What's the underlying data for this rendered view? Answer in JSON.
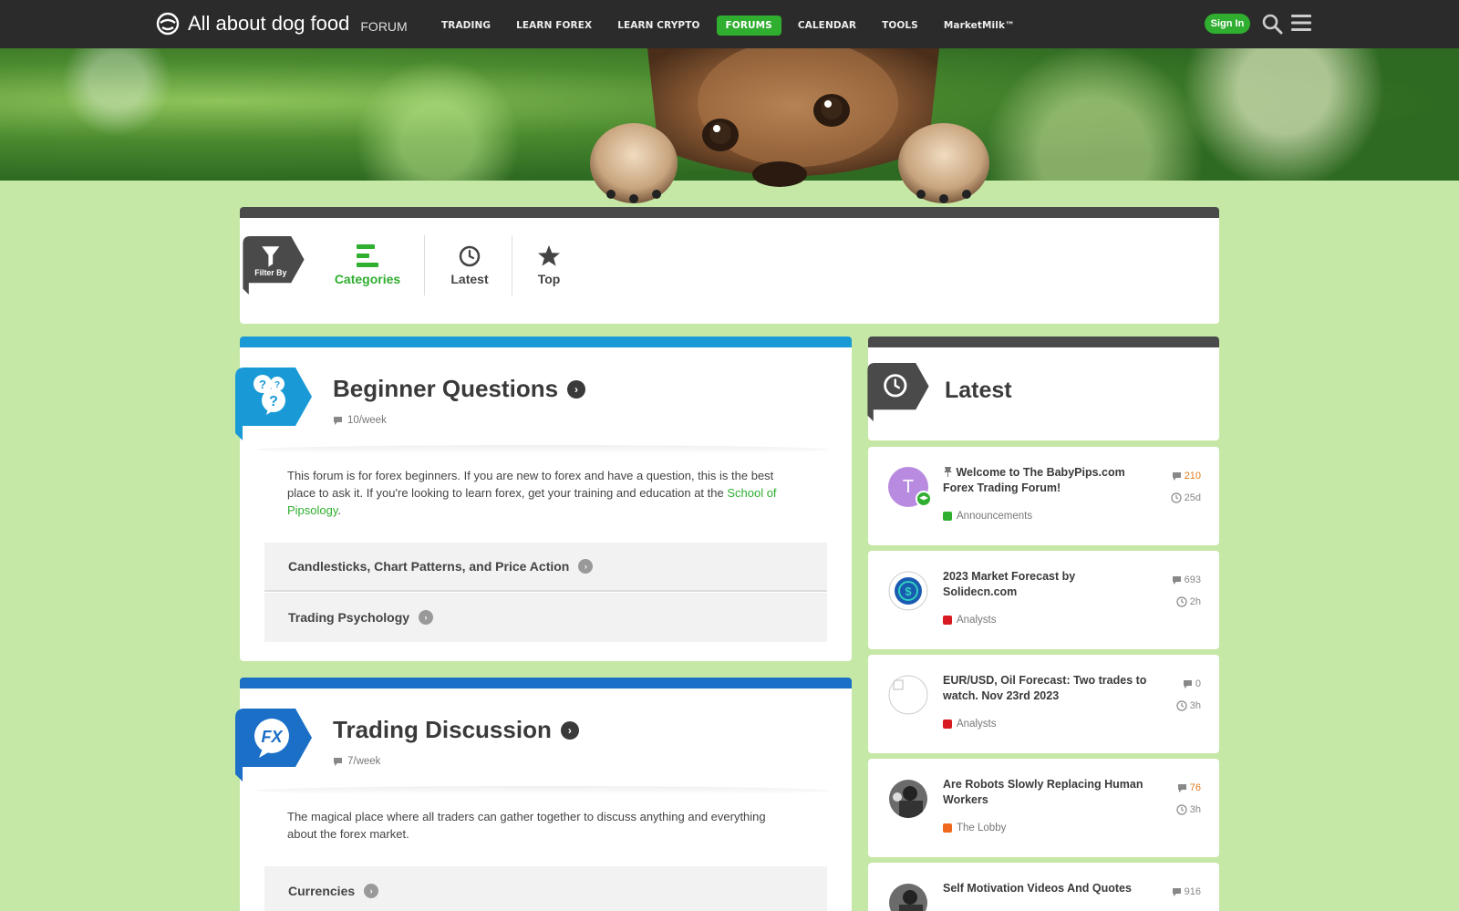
{
  "brand": {
    "name": "All about dog food",
    "sub": "FORUM"
  },
  "nav": [
    {
      "label": "TRADING",
      "active": false
    },
    {
      "label": "LEARN FOREX",
      "active": false
    },
    {
      "label": "LEARN CRYPTO",
      "active": false
    },
    {
      "label": "FORUMS",
      "active": true
    },
    {
      "label": "CALENDAR",
      "active": false
    },
    {
      "label": "TOOLS",
      "active": false
    },
    {
      "label": "MarketMilk™",
      "active": false
    }
  ],
  "header": {
    "signin_label": "Sign In"
  },
  "filter": {
    "tag_label": "Filter By",
    "tabs": [
      {
        "label": "Categories",
        "active": true
      },
      {
        "label": "Latest",
        "active": false
      },
      {
        "label": "Top",
        "active": false
      }
    ]
  },
  "categories": [
    {
      "title": "Beginner Questions",
      "rate": "10/week",
      "desc_text": "This forum is for forex beginners. If you are new to forex and have a question, this is the best place to ask it. If you're looking to learn forex, get your training and education at the ",
      "desc_link": "School of Pipsology",
      "desc_end": ".",
      "color": "#199ad6",
      "subcategories": [
        "Candlesticks, Chart Patterns, and Price Action",
        "Trading Psychology"
      ]
    },
    {
      "title": "Trading Discussion",
      "rate": "7/week",
      "desc_text": "The magical place where all traders can gather together to discuss anything and everything about the forex market.",
      "color": "#1b6fc6",
      "subcategories": [
        "Currencies"
      ]
    }
  ],
  "latest": {
    "title": "Latest",
    "topics": [
      {
        "title": "Welcome to The BabyPips.com Forex Trading Forum!",
        "pinned": true,
        "category": "Announcements",
        "cat_color": "#2fae2f",
        "replies": "210",
        "age": "25d",
        "avatar_letter": "T",
        "avatar_color": "#b88be0"
      },
      {
        "title": "2023 Market Forecast by Solidecn.com",
        "category": "Analysts",
        "cat_color": "#d71920",
        "replies": "693",
        "age": "2h"
      },
      {
        "title": "EUR/USD, Oil Forecast: Two trades to watch. Nov 23rd 2023",
        "category": "Analysts",
        "cat_color": "#d71920",
        "replies": "0",
        "age": "3h"
      },
      {
        "title": "Are Robots Slowly Replacing Human Workers",
        "category": "The Lobby",
        "cat_color": "#f0681e",
        "replies": "76",
        "age": "3h"
      },
      {
        "title": "Self Motivation Videos And Quotes",
        "replies": "916"
      }
    ]
  }
}
